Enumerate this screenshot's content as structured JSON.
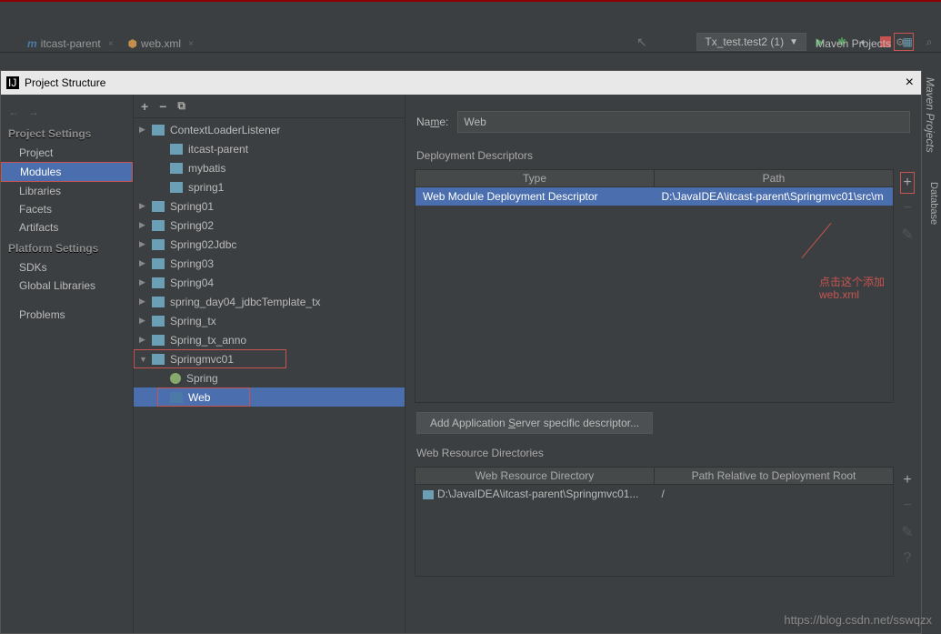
{
  "topbar": {
    "run_config": "Tx_test.test2 (1)",
    "tabs": [
      {
        "label": "itcast-parent",
        "icon": "m"
      },
      {
        "label": "web.xml",
        "icon": "xml"
      }
    ],
    "maven_projects": "Maven Projects"
  },
  "dialog": {
    "title": "Project Structure",
    "left": {
      "section1": "Project Settings",
      "items1": [
        "Project",
        "Modules",
        "Libraries",
        "Facets",
        "Artifacts"
      ],
      "section2": "Platform Settings",
      "items2": [
        "SDKs",
        "Global Libraries"
      ],
      "problems": "Problems"
    },
    "tree": [
      {
        "label": "ContextLoaderListener",
        "depth": 0,
        "exp": true
      },
      {
        "label": "itcast-parent",
        "depth": 1
      },
      {
        "label": "mybatis",
        "depth": 1
      },
      {
        "label": "spring1",
        "depth": 1
      },
      {
        "label": "Spring01",
        "depth": 0,
        "exp": true
      },
      {
        "label": "Spring02",
        "depth": 0,
        "exp": true
      },
      {
        "label": "Spring02Jdbc",
        "depth": 0,
        "exp": true
      },
      {
        "label": "Spring03",
        "depth": 0,
        "exp": true
      },
      {
        "label": "Spring04",
        "depth": 0,
        "exp": true
      },
      {
        "label": "spring_day04_jdbcTemplate_tx",
        "depth": 0,
        "exp": true
      },
      {
        "label": "Spring_tx",
        "depth": 0,
        "exp": true
      },
      {
        "label": "Spring_tx_anno",
        "depth": 0,
        "exp": true
      },
      {
        "label": "Springmvc01",
        "depth": 0,
        "open": true,
        "red": true
      },
      {
        "label": "Spring",
        "depth": 1,
        "leaf": true
      },
      {
        "label": "Web",
        "depth": 1,
        "webleaf": true,
        "sel": true,
        "red": true
      }
    ],
    "detail": {
      "name_label": "Name:",
      "name_value": "Web",
      "dd_label": "Deployment Descriptors",
      "dd_head": [
        "Type",
        "Path"
      ],
      "dd_row": [
        "Web Module Deployment Descriptor",
        "D:\\JavaIDEA\\itcast-parent\\Springmvc01\\src\\m"
      ],
      "add_server_btn": "Add Application Server specific descriptor...",
      "wrd_label": "Web Resource Directories",
      "wrd_head": [
        "Web Resource Directory",
        "Path Relative to Deployment Root"
      ],
      "wrd_row": [
        "D:\\JavaIDEA\\itcast-parent\\Springmvc01...",
        "/"
      ]
    }
  },
  "annotation": {
    "line1": "点击这个添加",
    "line2": "web.xml"
  },
  "right_dock": {
    "maven": "Maven Projects",
    "database": "Database"
  },
  "watermark": "https://blog.csdn.net/sswqzx"
}
